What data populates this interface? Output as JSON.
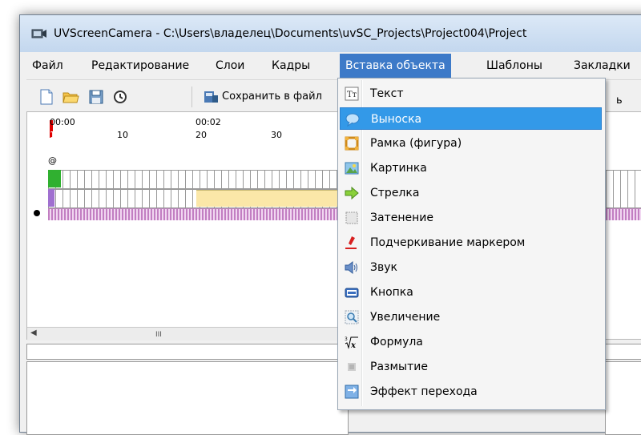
{
  "window": {
    "title": "UVScreenCamera - C:\\Users\\владелец\\Documents\\uvSC_Projects\\Project004\\Project"
  },
  "menubar": {
    "items": [
      "Файл",
      "Редактирование",
      "Слои",
      "Кадры",
      "Вставка объекта",
      "Шаблоны",
      "Закладки"
    ],
    "active_index": 4
  },
  "toolbar": {
    "save_label": "Сохранить в файл",
    "right_fragment": "ь"
  },
  "timeline": {
    "time_labels": [
      "00:00",
      "00:02"
    ],
    "frame_labels": [
      "1",
      "10",
      "20",
      "30"
    ],
    "at_symbol": "@",
    "scroll_thumb": "III"
  },
  "dropdown": {
    "items": [
      {
        "label": "Текст",
        "icon": "text-icon"
      },
      {
        "label": "Выноска",
        "icon": "callout-icon"
      },
      {
        "label": "Рамка (фигура)",
        "icon": "frame-shape-icon"
      },
      {
        "label": "Картинка",
        "icon": "picture-icon"
      },
      {
        "label": "Стрелка",
        "icon": "arrow-icon"
      },
      {
        "label": "Затенение",
        "icon": "shading-icon"
      },
      {
        "label": "Подчеркивание маркером",
        "icon": "marker-icon"
      },
      {
        "label": "Звук",
        "icon": "sound-icon"
      },
      {
        "label": "Кнопка",
        "icon": "button-icon"
      },
      {
        "label": "Увеличение",
        "icon": "zoom-icon"
      },
      {
        "label": "Формула",
        "icon": "formula-icon"
      },
      {
        "label": "Размытие",
        "icon": "blur-icon"
      },
      {
        "label": "Эффект перехода",
        "icon": "transition-icon"
      }
    ],
    "selected_index": 1
  },
  "colors": {
    "menu_active": "#3d7ac8",
    "item_selected": "#3399e8",
    "audio_track": "#c27ec2"
  }
}
